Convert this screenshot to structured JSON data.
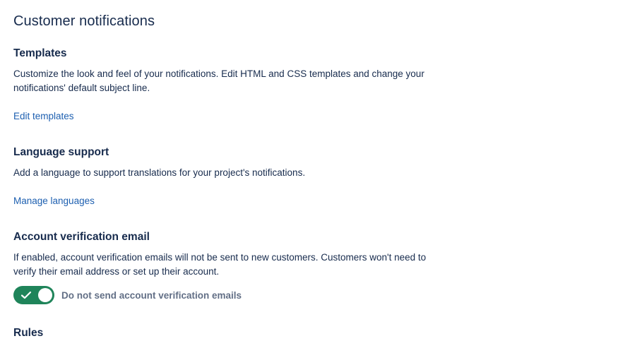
{
  "page": {
    "title": "Customer notifications"
  },
  "templates": {
    "heading": "Templates",
    "description": "Customize the look and feel of your notifications. Edit HTML and CSS templates and change your notifications' default subject line.",
    "link": "Edit templates"
  },
  "language_support": {
    "heading": "Language support",
    "description": "Add a language to support translations for your project's notifications.",
    "link": "Manage languages"
  },
  "account_verification": {
    "heading": "Account verification email",
    "description": "If enabled, account verification emails will not be sent to new customers. Customers won't need to verify their email address or set up their account.",
    "toggle": {
      "checked": true,
      "label": "Do not send account verification emails",
      "icon": "checkmark-icon"
    }
  },
  "rules": {
    "heading": "Rules"
  },
  "colors": {
    "text": "#172b4d",
    "link": "#1d5fb0",
    "toggle_on": "#1f845a",
    "toggle_label": "#626f86"
  }
}
